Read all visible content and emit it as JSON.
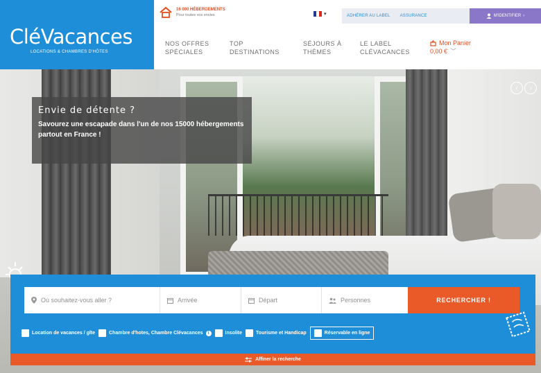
{
  "brand": {
    "logo_text": "CléVacances",
    "tagline": "LOCATIONS & CHAMBRES D'HÔTES",
    "colors": {
      "primary_blue": "#1f8ed9",
      "accent_orange": "#ea5a28",
      "login_purple": "#8a77c7"
    }
  },
  "promo": {
    "icon": "house-icon",
    "title": "16 000 HÉBERGEMENTS",
    "subtitle": "Pour toutes vos envies"
  },
  "language": {
    "selected": "FR",
    "icon": "chevron-down-icon"
  },
  "topbar": {
    "links": [
      "ADHÉRER AU LABEL",
      "ASSURANCE"
    ],
    "login_label": "M'IDENTIFIER",
    "login_icon": "user-icon"
  },
  "nav": {
    "items": [
      {
        "line1": "NOS OFFRES",
        "line2": "SPÉCIALES"
      },
      {
        "line1": "TOP",
        "line2": "DESTINATIONS"
      },
      {
        "line1": "SÉJOURS À",
        "line2": "THÈMES"
      },
      {
        "line1": "LE LABEL",
        "line2": "CLÉVACANCES"
      }
    ]
  },
  "cart": {
    "label": "Mon Panier",
    "amount": "0,00 €",
    "icon": "basket-icon"
  },
  "hero": {
    "title": "Envie de détente ?",
    "text": "Savourez une escapade dans l'un de nos 15000 hébergements partout en France !",
    "prev_icon": "chevron-left-icon",
    "next_icon": "chevron-right-icon"
  },
  "search": {
    "destination_placeholder": "Où souhaitez-vous aller ?",
    "arrival_placeholder": "Arrivée",
    "departure_placeholder": "Départ",
    "persons_placeholder": "Personnes",
    "button_label": "RECHERCHER !",
    "filters": [
      "Location de vacances / gîte",
      "Chambre d'hotes, Chambre Clévacances",
      "Insolite",
      "Tourisme et Handicap"
    ],
    "bookable_label": "Réservable en ligne",
    "refine_label": "Affiner la recherche"
  }
}
